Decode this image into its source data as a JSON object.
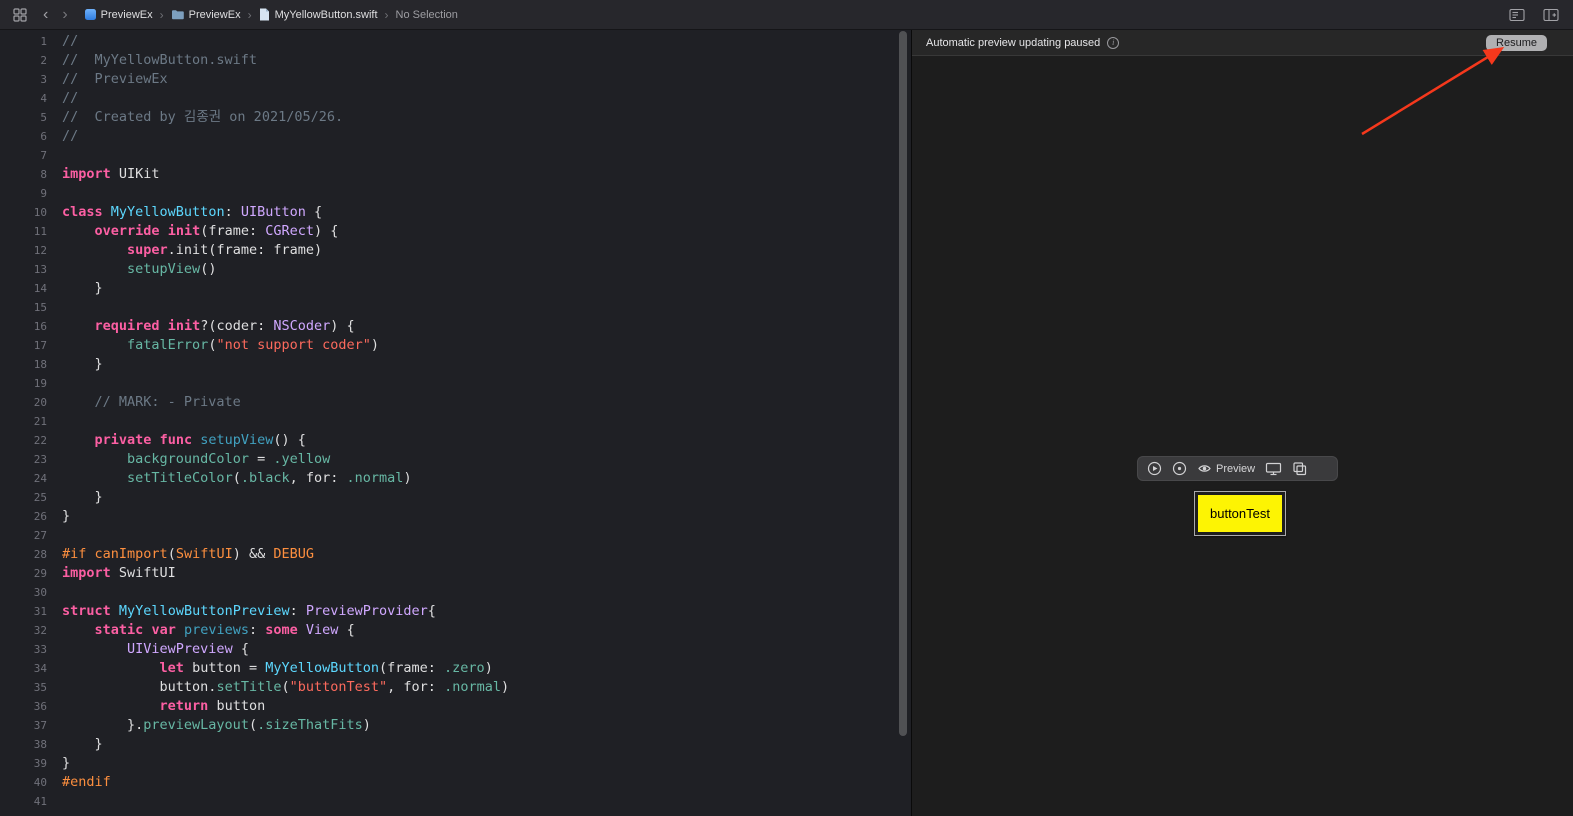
{
  "colors": {
    "arrow_red": "#f5381c",
    "button_yellow": "#fdf403",
    "button_text": "#000000"
  },
  "icons": {
    "back": "‹",
    "forward": "›",
    "crumb_separator": "›",
    "info": "i"
  },
  "top_bar": {
    "breadcrumbs": [
      {
        "label": "PreviewEx"
      },
      {
        "label": "PreviewEx"
      },
      {
        "label": "MyYellowButton.swift"
      },
      {
        "label": "No Selection"
      }
    ]
  },
  "editor": {
    "token_colors": {
      "c": "#6c7986",
      "k": "#fc5fa3",
      "td": "#5dd8ff",
      "t": "#d0a8ff",
      "f": "#67b7a4",
      "d": "#41a1c0",
      "s": "#fc6a5d",
      "o": "#fd8f3f",
      "p": "#dfdfe0"
    },
    "lines": [
      {
        "n": "1",
        "seg": [
          [
            "//",
            "c"
          ]
        ]
      },
      {
        "n": "2",
        "seg": [
          [
            "//  MyYellowButton.swift",
            "c"
          ]
        ]
      },
      {
        "n": "3",
        "seg": [
          [
            "//  PreviewEx",
            "c"
          ]
        ]
      },
      {
        "n": "4",
        "seg": [
          [
            "//",
            "c"
          ]
        ]
      },
      {
        "n": "5",
        "seg": [
          [
            "//  Created by 김종권 on 2021/05/26.",
            "c"
          ]
        ]
      },
      {
        "n": "6",
        "seg": [
          [
            "//",
            "c"
          ]
        ]
      },
      {
        "n": "7",
        "seg": []
      },
      {
        "n": "8",
        "seg": [
          [
            "import",
            "k"
          ],
          [
            " UIKit",
            "p"
          ]
        ]
      },
      {
        "n": "9",
        "seg": []
      },
      {
        "n": "10",
        "seg": [
          [
            "class",
            "k"
          ],
          [
            " ",
            "p"
          ],
          [
            "MyYellowButton",
            "td"
          ],
          [
            ": ",
            "p"
          ],
          [
            "UIButton",
            "t"
          ],
          [
            " {",
            "p"
          ]
        ]
      },
      {
        "n": "11",
        "seg": [
          [
            "    ",
            "p"
          ],
          [
            "override",
            "k"
          ],
          [
            " ",
            "p"
          ],
          [
            "init",
            "k"
          ],
          [
            "(frame: ",
            "p"
          ],
          [
            "CGRect",
            "t"
          ],
          [
            ") {",
            "p"
          ]
        ]
      },
      {
        "n": "12",
        "seg": [
          [
            "        ",
            "p"
          ],
          [
            "super",
            "k"
          ],
          [
            ".init(frame: frame)",
            "p"
          ]
        ]
      },
      {
        "n": "13",
        "seg": [
          [
            "        ",
            "p"
          ],
          [
            "setupView",
            "f"
          ],
          [
            "()",
            "p"
          ]
        ]
      },
      {
        "n": "14",
        "seg": [
          [
            "    }",
            "p"
          ]
        ]
      },
      {
        "n": "15",
        "seg": []
      },
      {
        "n": "16",
        "seg": [
          [
            "    ",
            "p"
          ],
          [
            "required",
            "k"
          ],
          [
            " ",
            "p"
          ],
          [
            "init",
            "k"
          ],
          [
            "?(coder: ",
            "p"
          ],
          [
            "NSCoder",
            "t"
          ],
          [
            ") {",
            "p"
          ]
        ]
      },
      {
        "n": "17",
        "seg": [
          [
            "        ",
            "p"
          ],
          [
            "fatalError",
            "f"
          ],
          [
            "(",
            "p"
          ],
          [
            "\"not support coder\"",
            "s"
          ],
          [
            ")",
            "p"
          ]
        ]
      },
      {
        "n": "18",
        "seg": [
          [
            "    }",
            "p"
          ]
        ]
      },
      {
        "n": "19",
        "seg": []
      },
      {
        "n": "20",
        "seg": [
          [
            "    // MARK: - Private",
            "c"
          ]
        ]
      },
      {
        "n": "21",
        "seg": []
      },
      {
        "n": "22",
        "seg": [
          [
            "    ",
            "p"
          ],
          [
            "private",
            "k"
          ],
          [
            " ",
            "p"
          ],
          [
            "func",
            "k"
          ],
          [
            " ",
            "p"
          ],
          [
            "setupView",
            "d"
          ],
          [
            "() {",
            "p"
          ]
        ]
      },
      {
        "n": "23",
        "seg": [
          [
            "        ",
            "p"
          ],
          [
            "backgroundColor",
            "f"
          ],
          [
            " = ",
            "p"
          ],
          [
            ".yellow",
            "f"
          ]
        ]
      },
      {
        "n": "24",
        "seg": [
          [
            "        ",
            "p"
          ],
          [
            "setTitleColor",
            "f"
          ],
          [
            "(",
            "p"
          ],
          [
            ".black",
            "f"
          ],
          [
            ", for: ",
            "p"
          ],
          [
            ".normal",
            "f"
          ],
          [
            ")",
            "p"
          ]
        ]
      },
      {
        "n": "25",
        "seg": [
          [
            "    }",
            "p"
          ]
        ]
      },
      {
        "n": "26",
        "seg": [
          [
            "}",
            "p"
          ]
        ]
      },
      {
        "n": "27",
        "seg": []
      },
      {
        "n": "28",
        "seg": [
          [
            "#if",
            "o"
          ],
          [
            " ",
            "p"
          ],
          [
            "canImport",
            "o"
          ],
          [
            "(",
            "p"
          ],
          [
            "SwiftUI",
            "o"
          ],
          [
            ") && ",
            "p"
          ],
          [
            "DEBUG",
            "o"
          ]
        ]
      },
      {
        "n": "29",
        "seg": [
          [
            "import",
            "k"
          ],
          [
            " SwiftUI",
            "p"
          ]
        ]
      },
      {
        "n": "30",
        "seg": []
      },
      {
        "n": "31",
        "seg": [
          [
            "struct",
            "k"
          ],
          [
            " ",
            "p"
          ],
          [
            "MyYellowButtonPreview",
            "td"
          ],
          [
            ": ",
            "p"
          ],
          [
            "PreviewProvider",
            "t"
          ],
          [
            "{",
            "p"
          ]
        ]
      },
      {
        "n": "32",
        "seg": [
          [
            "    ",
            "p"
          ],
          [
            "static",
            "k"
          ],
          [
            " ",
            "p"
          ],
          [
            "var",
            "k"
          ],
          [
            " ",
            "p"
          ],
          [
            "previews",
            "d"
          ],
          [
            ": ",
            "p"
          ],
          [
            "some",
            "k"
          ],
          [
            " ",
            "p"
          ],
          [
            "View",
            "t"
          ],
          [
            " {",
            "p"
          ]
        ]
      },
      {
        "n": "33",
        "seg": [
          [
            "        ",
            "p"
          ],
          [
            "UIViewPreview",
            "t"
          ],
          [
            " {",
            "p"
          ]
        ]
      },
      {
        "n": "34",
        "seg": [
          [
            "            ",
            "p"
          ],
          [
            "let",
            "k"
          ],
          [
            " button = ",
            "p"
          ],
          [
            "MyYellowButton",
            "td"
          ],
          [
            "(frame: ",
            "p"
          ],
          [
            ".zero",
            "f"
          ],
          [
            ")",
            "p"
          ]
        ]
      },
      {
        "n": "35",
        "seg": [
          [
            "            button.",
            "p"
          ],
          [
            "setTitle",
            "f"
          ],
          [
            "(",
            "p"
          ],
          [
            "\"buttonTest\"",
            "s"
          ],
          [
            ", for: ",
            "p"
          ],
          [
            ".normal",
            "f"
          ],
          [
            ")",
            "p"
          ]
        ]
      },
      {
        "n": "36",
        "seg": [
          [
            "            ",
            "p"
          ],
          [
            "return",
            "k"
          ],
          [
            " button",
            "p"
          ]
        ]
      },
      {
        "n": "37",
        "seg": [
          [
            "        }.",
            "p"
          ],
          [
            "previewLayout",
            "f"
          ],
          [
            "(",
            "p"
          ],
          [
            ".sizeThatFits",
            "f"
          ],
          [
            ")",
            "p"
          ]
        ]
      },
      {
        "n": "38",
        "seg": [
          [
            "    }",
            "p"
          ]
        ]
      },
      {
        "n": "39",
        "seg": [
          [
            "}",
            "p"
          ]
        ]
      },
      {
        "n": "40",
        "seg": [
          [
            "#endif",
            "o"
          ]
        ]
      },
      {
        "n": "41",
        "seg": []
      }
    ]
  },
  "preview": {
    "banner": {
      "message": "Automatic preview updating paused",
      "resume_label": "Resume"
    },
    "toolbar": {
      "preview_label": "Preview"
    },
    "canvas": {
      "button_title": "buttonTest"
    }
  }
}
